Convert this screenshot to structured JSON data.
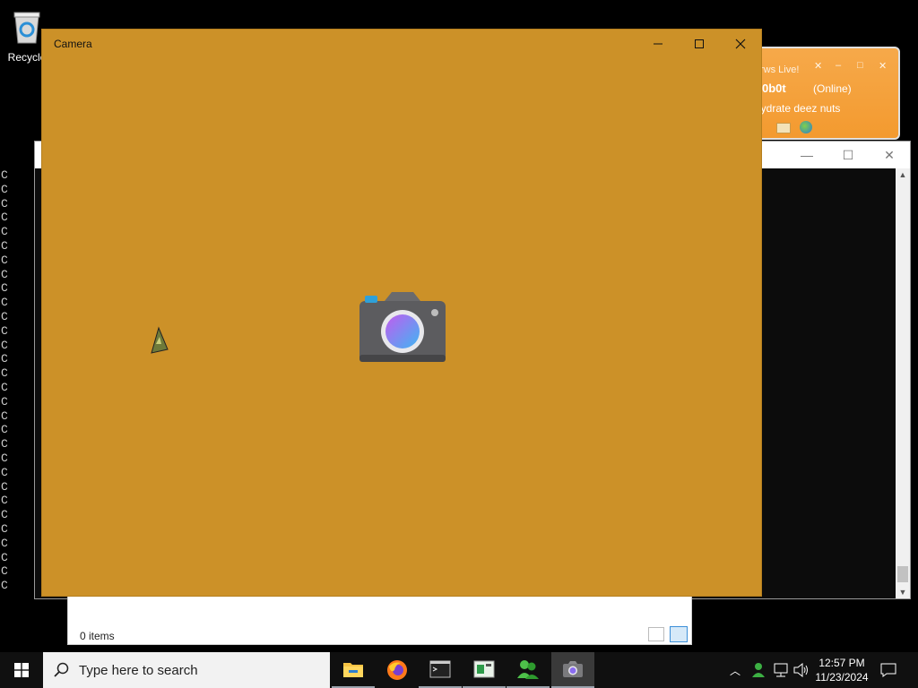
{
  "desktop": {
    "recycle_label": "Recycle"
  },
  "messenger": {
    "title": "rws Live!",
    "username": "0b0t",
    "status": "(Online)",
    "message": "eydrate deez nuts"
  },
  "console": {
    "line_char": "C",
    "lines": 30
  },
  "explorer": {
    "status": "0 items"
  },
  "camera": {
    "title": "Camera"
  },
  "taskbar": {
    "search_placeholder": "Type here to search",
    "time": "12:57 PM",
    "date": "11/23/2024"
  },
  "colors": {
    "camera_bg": "#cc9128",
    "taskbar_bg": "#101010",
    "messenger_orange": "#f5a341"
  }
}
